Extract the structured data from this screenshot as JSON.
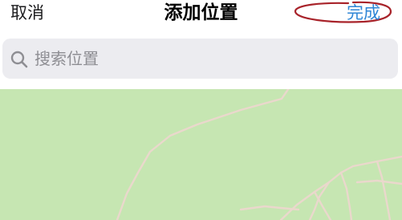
{
  "nav": {
    "cancel_label": "取消",
    "title": "添加位置",
    "done_label": "完成"
  },
  "search": {
    "placeholder": "搜索位置",
    "value": ""
  },
  "colors": {
    "done_accent": "#2f86d6",
    "annotation_circle": "#a8232a",
    "map_background": "#c6e6b2",
    "road": "#ead8cc"
  },
  "icons": {
    "search": "search-icon"
  }
}
